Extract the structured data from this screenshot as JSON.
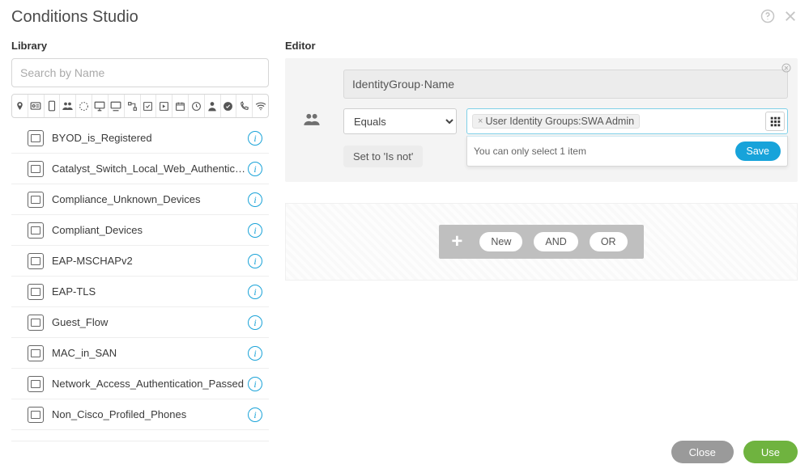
{
  "header": {
    "title": "Conditions Studio"
  },
  "library": {
    "title": "Library",
    "search_placeholder": "Search by Name",
    "filter_icons": [
      "location-pin-icon",
      "badge-icon",
      "device-icon",
      "group-icon",
      "dotted-circle-icon",
      "monitor-icon",
      "desktop-icon",
      "flow-icon",
      "window-check-icon",
      "window-arrow-icon",
      "calendar-icon",
      "clock-icon",
      "person-icon",
      "check-circle-icon",
      "phone-icon",
      "wifi-icon"
    ],
    "items": [
      {
        "label": "BYOD_is_Registered"
      },
      {
        "label": "Catalyst_Switch_Local_Web_Authentication"
      },
      {
        "label": "Compliance_Unknown_Devices"
      },
      {
        "label": "Compliant_Devices"
      },
      {
        "label": "EAP-MSCHAPv2"
      },
      {
        "label": "EAP-TLS"
      },
      {
        "label": "Guest_Flow"
      },
      {
        "label": "MAC_in_SAN"
      },
      {
        "label": "Network_Access_Authentication_Passed"
      },
      {
        "label": "Non_Cisco_Profiled_Phones"
      }
    ]
  },
  "editor": {
    "title": "Editor",
    "attribute": "IdentityGroup·Name",
    "operator": "Equals",
    "value_chip": "User Identity Groups:SWA Admin",
    "dropdown_msg": "You can only select 1 item",
    "save_label": "Save",
    "set_isnot_label": "Set to 'Is not'",
    "add": {
      "new": "New",
      "and": "AND",
      "or": "OR"
    }
  },
  "footer": {
    "close": "Close",
    "use": "Use"
  }
}
